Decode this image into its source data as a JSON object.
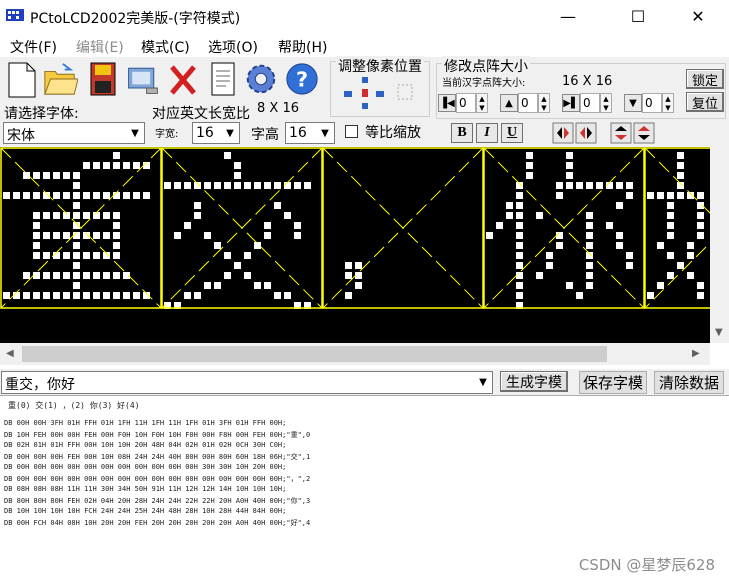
{
  "window": {
    "title": "PCtoLCD2002完美版-(字符模式)",
    "minimize": "—",
    "maximize": "☐",
    "close": "✕"
  },
  "menu": [
    {
      "label": "文件(F)",
      "enabled": true
    },
    {
      "label": "编辑(E)",
      "enabled": false
    },
    {
      "label": "模式(C)",
      "enabled": true
    },
    {
      "label": "选项(O)",
      "enabled": true
    },
    {
      "label": "帮助(H)",
      "enabled": true
    }
  ],
  "toolbar": {
    "icons": [
      "new-icon",
      "open-icon",
      "save-icon",
      "export-icon",
      "delete-icon",
      "notepad-icon",
      "settings-gear-icon",
      "help-icon"
    ]
  },
  "font_panel": {
    "choose_font_label": "请选择字体:",
    "font_value": "宋体",
    "width_label": "字宽:",
    "width_value": "16",
    "height_label": "字高",
    "height_value": "16",
    "ratio_label": "对应英文长宽比",
    "ratio_value": "8 X 16",
    "scale_label": "等比缩放",
    "bold_label": "B",
    "italic_label": "I",
    "underline_label": "U"
  },
  "pixel_adjust": {
    "title": "调整像素位置"
  },
  "matrix_size": {
    "title": "修改点阵大小",
    "current_label": "当前汉字点阵大小:",
    "current_value": "16 X 16",
    "lock_label": "锁定",
    "reset_label": "复位",
    "spinners": [
      "0",
      "0",
      "0",
      "0"
    ]
  },
  "input": {
    "text": "重交，你好",
    "generate_label": "生成字模",
    "save_label": "保存字模",
    "clear_label": "清除数据"
  },
  "output": {
    "header": "重(0) 交(1) ，(2) 你(3) 好(4)",
    "lines": [
      "DB 00H 00H 3FH 01H FFH 01H 1FH 11H 1FH 11H 1FH 01H 3FH 01H FFH 00H;",
      "DB 10H FEH 00H 00H FEH 00H F0H 10H F0H 10H F0H 00H F8H 00H FEH 00H;\"重\",0",
      "DB 02H 01H 01H FFH 00H 10H 10H 20H 48H 04H 02H 01H 02H 0CH 30H C0H;",
      "DB 00H 00H 00H FEH 00H 10H 08H 24H 24H 40H 80H 00H 80H 60H 18H 06H;\"交\",1",
      "DB 00H 00H 00H 00H 00H 00H 00H 00H 00H 00H 00H 30H 30H 10H 20H 00H;",
      "DB 00H 00H 00H 00H 00H 00H 00H 00H 00H 00H 00H 00H 00H 00H 00H 00H;\"，\",2",
      "DB 08H 08H 08H 11H 11H 30H 34H 50H 91H 11H 12H 12H 14H 10H 10H 10H;",
      "DB 80H 80H 80H FEH 02H 04H 20H 28H 24H 24H 22H 22H 20H A0H 40H 00H;\"你\",3",
      "DB 10H 10H 10H 10H FCH 24H 24H 25H 24H 48H 28H 10H 28H 44H 84H 00H;",
      "DB 00H FCH 04H 08H 10H 20H 20H FEH 20H 20H 20H 20H 20H A0H 40H 00H;\"好\",4"
    ]
  },
  "watermark": "CSDN @星梦辰628",
  "colors": {
    "canvas_bg": "#000000",
    "pixel_on": "#ffffff",
    "grid_line": "#ffff00"
  }
}
